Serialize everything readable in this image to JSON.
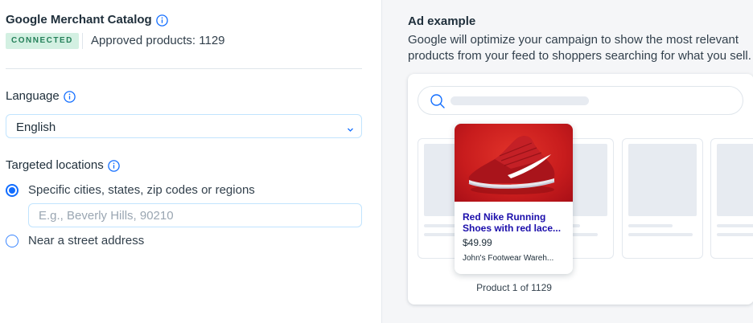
{
  "catalog": {
    "title": "Google Merchant Catalog",
    "status_badge": "CONNECTED",
    "approved_label": "Approved products: 1129"
  },
  "language": {
    "label": "Language",
    "selected": "English"
  },
  "locations": {
    "label": "Targeted locations",
    "options": [
      {
        "label": "Specific cities, states, zip codes or regions",
        "selected": true
      },
      {
        "label": "Near a street address",
        "selected": false
      }
    ],
    "input_placeholder": "E.g., Beverly Hills, 90210",
    "input_value": ""
  },
  "ad_example": {
    "title": "Ad example",
    "description": "Google will optimize your campaign to show the most relevant products from your feed to shoppers searching for what you sell.",
    "product": {
      "name": "Red Nike Running Shoes with red lace...",
      "price": "$49.99",
      "store": "John's Footwear Wareh...",
      "image_icon": "red-sneaker-image"
    },
    "counter": "Product 1 of 1129"
  },
  "colors": {
    "accent": "#116dff",
    "badge_bg": "#d3f0e2",
    "badge_text": "#25805a",
    "product_link": "#1a0dab",
    "panel_bg": "#f5f6f8"
  }
}
